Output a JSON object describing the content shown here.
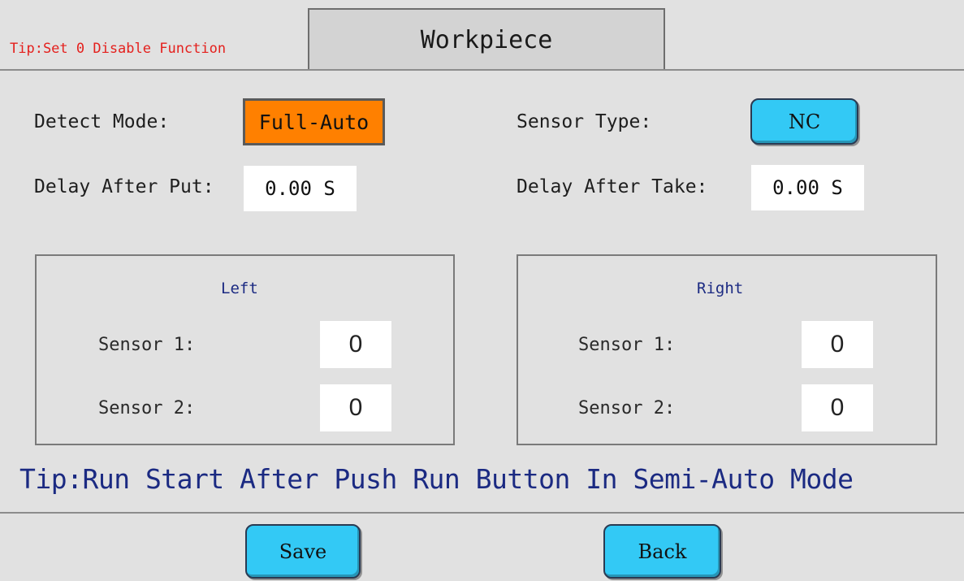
{
  "header": {
    "tip": "Tip:Set 0 Disable Function",
    "title": "Workpiece"
  },
  "settings": {
    "detect_mode_label": "Detect Mode:",
    "detect_mode_value": "Full-Auto",
    "sensor_type_label": "Sensor Type:",
    "sensor_type_value": "NC",
    "delay_after_put_label": "Delay After Put:",
    "delay_after_put_value": "0.00 S",
    "delay_after_take_label": "Delay After Take:",
    "delay_after_take_value": "0.00 S"
  },
  "left_group": {
    "title": "Left",
    "sensor1_label": "Sensor 1:",
    "sensor1_value": "0",
    "sensor2_label": "Sensor 2:",
    "sensor2_value": "0"
  },
  "right_group": {
    "title": "Right",
    "sensor1_label": "Sensor 1:",
    "sensor1_value": "0",
    "sensor2_label": "Sensor 2:",
    "sensor2_value": "0"
  },
  "footer_tip": "Tip:Run Start After Push Run Button In Semi-Auto Mode",
  "buttons": {
    "save": "Save",
    "back": "Back"
  },
  "colors": {
    "background": "#e1e1e1",
    "accent_orange": "#ff8000",
    "button_blue": "#33c9f5",
    "tip_red": "#e4201d",
    "text_navy": "#1b2a82"
  }
}
